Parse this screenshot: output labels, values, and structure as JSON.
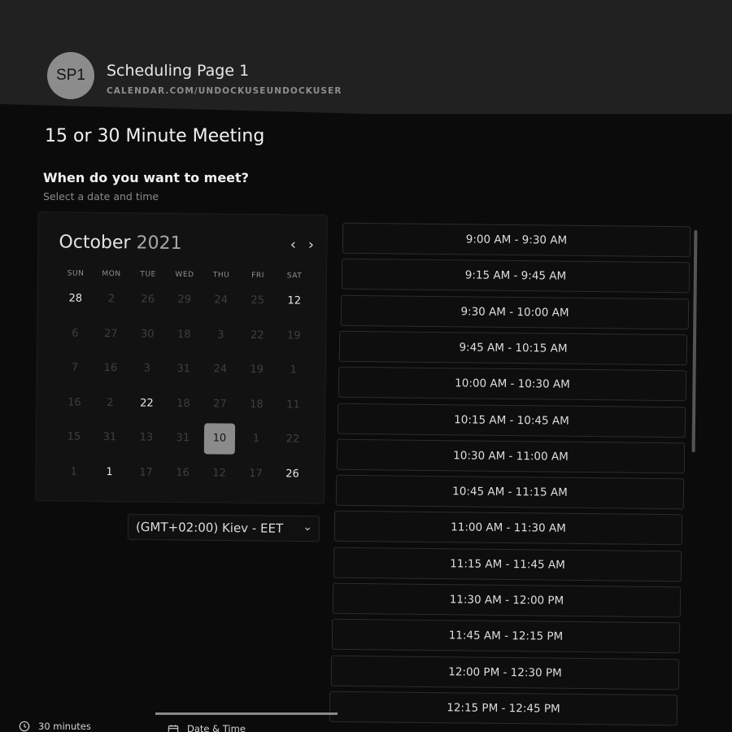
{
  "header": {
    "avatar_initials": "SP1",
    "page_name": "Scheduling Page 1",
    "page_url": "CALENDAR.COM/UNDOCKUSEUNDOCKUSER"
  },
  "meeting": {
    "title": "15 or 30 Minute Meeting",
    "question": "When do you want to meet?",
    "subtitle": "Select a date and time"
  },
  "calendar": {
    "month": "October",
    "year": "2021",
    "prev_label": "‹",
    "next_label": "›",
    "weekdays": [
      "SUN",
      "MON",
      "TUE",
      "WED",
      "THU",
      "FRI",
      "SAT"
    ],
    "weeks": [
      [
        "28",
        "2",
        "26",
        "29",
        "24",
        "25",
        "12"
      ],
      [
        "6",
        "27",
        "30",
        "18",
        "3",
        "22",
        "19"
      ],
      [
        "7",
        "16",
        "3",
        "31",
        "24",
        "19",
        "1"
      ],
      [
        "16",
        "2",
        "22",
        "18",
        "27",
        "18",
        "11"
      ],
      [
        "15",
        "31",
        "13",
        "31",
        "10",
        "1",
        "22"
      ],
      [
        "1",
        "1",
        "17",
        "16",
        "12",
        "17",
        "26"
      ]
    ],
    "available_days": [
      [
        0,
        0
      ],
      [
        0,
        6
      ],
      [
        3,
        2
      ],
      [
        5,
        1
      ],
      [
        5,
        6
      ]
    ],
    "selected_day": [
      4,
      4
    ]
  },
  "timezone": {
    "label": "(GMT+02:00) Kiev - EET",
    "chevron": "⌄"
  },
  "slots": [
    "9:00 AM - 9:30 AM",
    "9:15 AM - 9:45 AM",
    "9:30 AM - 10:00 AM",
    "9:45 AM - 10:15 AM",
    "10:00 AM - 10:30 AM",
    "10:15 AM - 10:45 AM",
    "10:30 AM - 11:00 AM",
    "10:45 AM - 11:15 AM",
    "11:00 AM - 11:30 AM",
    "11:15 AM - 11:45 AM",
    "11:30 AM - 12:00 PM",
    "11:45 AM - 12:15 PM",
    "12:00 PM - 12:30 PM",
    "12:15 PM - 12:45 PM"
  ],
  "footer": {
    "duration_label": "30 minutes",
    "datetime_label": "Date & Time",
    "duration_icon": "clock-icon",
    "datetime_icon": "calendar-icon"
  }
}
